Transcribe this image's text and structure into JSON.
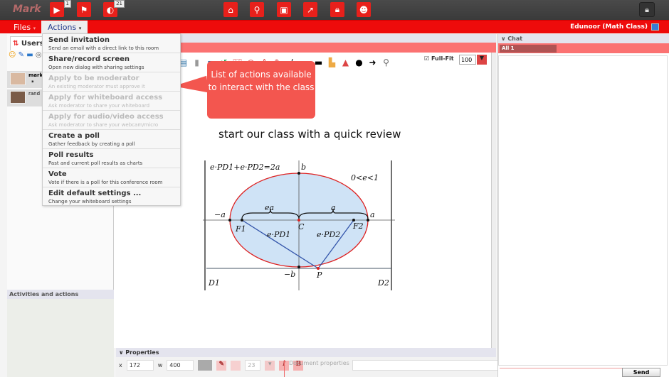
{
  "topbar": {
    "user_name": "Mark",
    "buttons": [
      {
        "icon": "play-icon",
        "badge": "1"
      },
      {
        "icon": "flag-icon",
        "badge": ""
      },
      {
        "icon": "globe-icon",
        "badge": "21"
      },
      {
        "icon": "home-icon"
      },
      {
        "icon": "search-icon"
      },
      {
        "icon": "contact-icon"
      },
      {
        "icon": "share-icon"
      },
      {
        "icon": "lock-icon"
      },
      {
        "icon": "users-icon"
      }
    ],
    "right_lock_icon": "lock-icon"
  },
  "menubar": {
    "files_label": "Files",
    "actions_label": "Actions",
    "room_title": "Edunoor (Math Class)"
  },
  "sidebar": {
    "users_tab_label": "Users",
    "users": [
      {
        "name": "mark",
        "sub": "*"
      },
      {
        "name": "rand",
        "sub": ""
      }
    ],
    "activities_title": "Activities and actions"
  },
  "actions_menu": [
    {
      "title": "Send invitation",
      "subtitle": "Send an email with a direct link to this room",
      "enabled": true
    },
    {
      "title": "Share/record screen",
      "subtitle": "Open new dialog with sharing settings",
      "enabled": true
    },
    {
      "title": "Apply to be moderator",
      "subtitle": "An existing moderator must approve it",
      "enabled": false
    },
    {
      "title": "Apply for whiteboard access",
      "subtitle": "Ask moderator to share your whiteboard",
      "enabled": false
    },
    {
      "title": "Apply for audio/video access",
      "subtitle": "Ask moderator to share your webcam/micro",
      "enabled": false
    },
    {
      "title": "Create a poll",
      "subtitle": "Gather feedback by creating a poll",
      "enabled": true
    },
    {
      "title": "Poll results",
      "subtitle": "Past and current poll results as charts",
      "enabled": true
    },
    {
      "title": "Vote",
      "subtitle": "Vote if there is a poll for this conference room",
      "enabled": true
    },
    {
      "title": "Edit default settings ...",
      "subtitle": "Change your whiteboard settings",
      "enabled": true
    }
  ],
  "callout": {
    "text": "List of actions available to interact with the class"
  },
  "whiteboard": {
    "fullfit_label": "Full-Fit",
    "fullfit_checked": true,
    "zoom_value": "100",
    "text": "start our class with a quick review",
    "figure_labels": {
      "equation": "e·PD1+e·PD2=2a",
      "condition": "0<e<1",
      "b": "b",
      "neg_b": "−b",
      "a": "a",
      "neg_a": "−a",
      "ea": "ea",
      "a_top": "a",
      "F1": "F1",
      "F2": "F2",
      "C": "C",
      "P": "P",
      "ePD1": "e·PD1",
      "ePD2": "e·PD2",
      "D1": "D1",
      "D2": "D2"
    }
  },
  "properties": {
    "title": "Properties",
    "x_label": "x",
    "x_value": "172",
    "w_label": "w",
    "w_value": "400",
    "font_size": "23",
    "italic_label": "I",
    "bold_label": "B",
    "doc_props_label": "Document properties"
  },
  "chat": {
    "title": "Chat",
    "tab_all": "All 1",
    "send_label": "Send"
  }
}
